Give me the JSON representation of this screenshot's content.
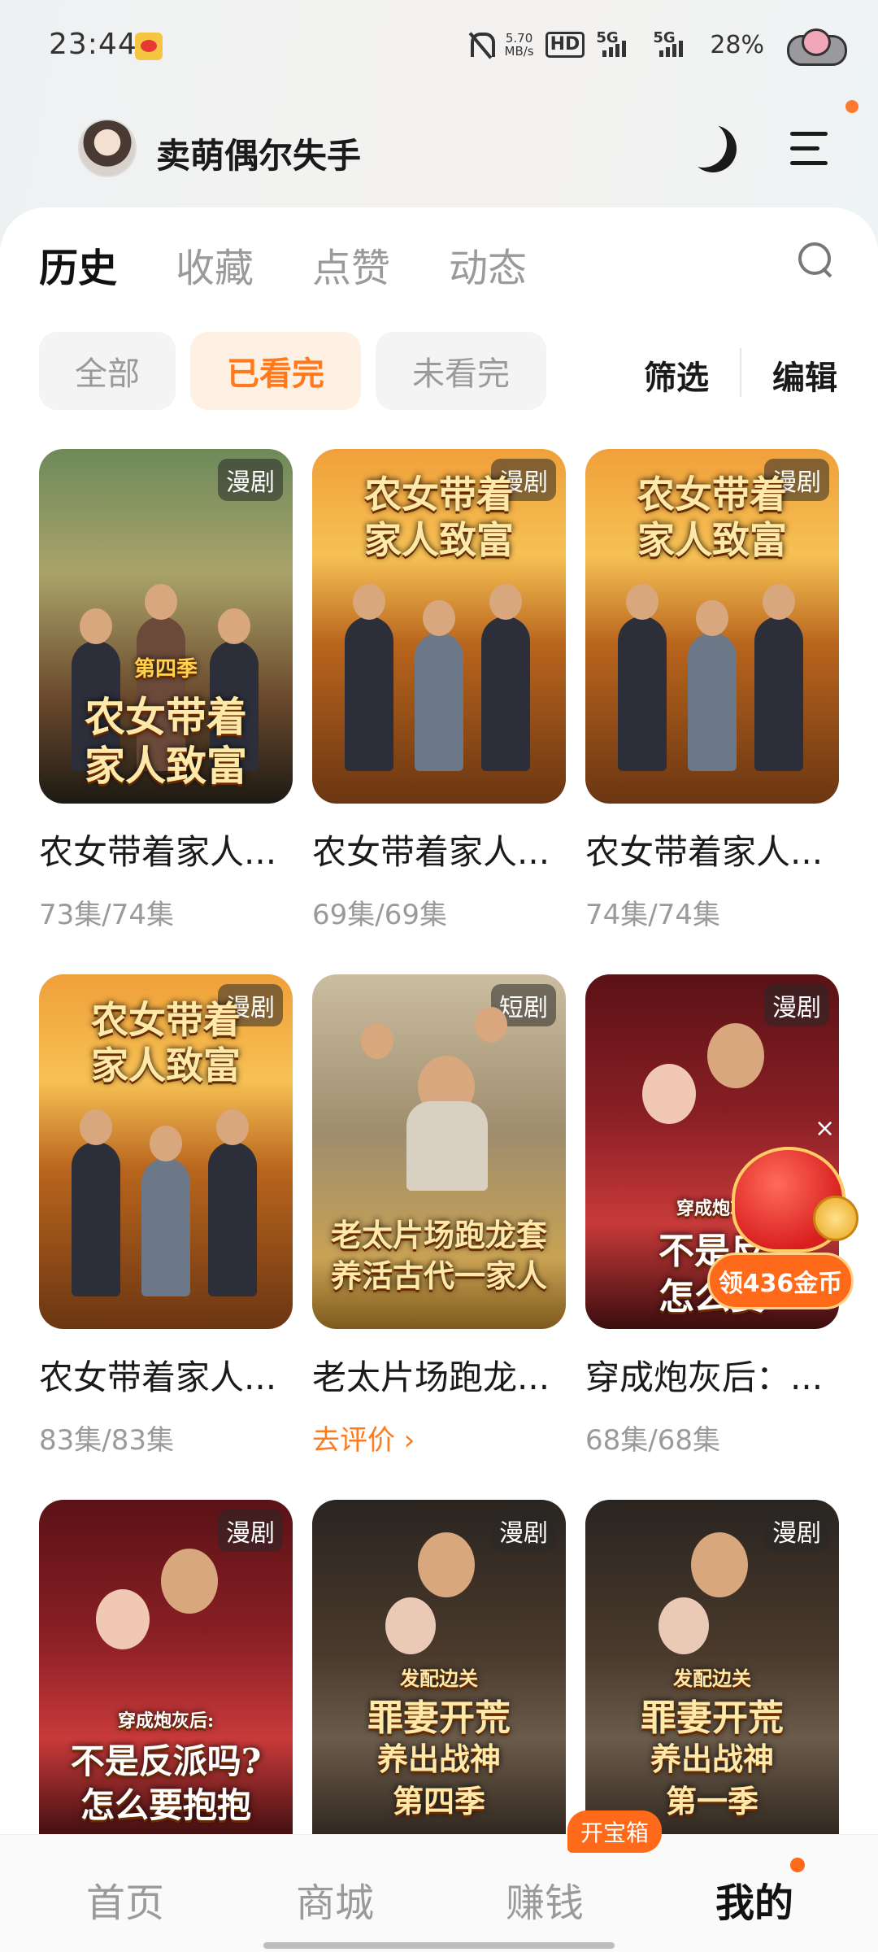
{
  "status_bar": {
    "time": "23:44",
    "net_speed_value": "5.70",
    "net_speed_unit": "MB/s",
    "hd_label": "HD",
    "signal1": "5G",
    "signal2": "5G",
    "battery": "28%"
  },
  "user": {
    "name": "卖萌偶尔失手"
  },
  "tabs": [
    {
      "label": "历史",
      "active": true
    },
    {
      "label": "收藏",
      "active": false
    },
    {
      "label": "点赞",
      "active": false
    },
    {
      "label": "动态",
      "active": false
    }
  ],
  "filters": {
    "chips": [
      {
        "label": "全部",
        "selected": false
      },
      {
        "label": "已看完",
        "selected": true
      },
      {
        "label": "未看完",
        "selected": false
      }
    ],
    "filter_label": "筛选",
    "edit_label": "编辑"
  },
  "items": [
    {
      "title": "农女带着家人...",
      "sub": "73集/74集",
      "badge": "漫剧",
      "poster_text_1": "第四季",
      "poster_text_2": "农女带着",
      "poster_text_3": "家人致富"
    },
    {
      "title": "农女带着家人...",
      "sub": "69集/69集",
      "badge": "漫剧",
      "poster_text_1": "农女带着",
      "poster_text_2": "家人致富"
    },
    {
      "title": "农女带着家人...",
      "sub": "74集/74集",
      "badge": "漫剧",
      "poster_text_1": "农女带着",
      "poster_text_2": "家人致富"
    },
    {
      "title": "农女带着家人...",
      "sub": "83集/83集",
      "badge": "漫剧",
      "poster_text_1": "农女带着",
      "poster_text_2": "家人致富"
    },
    {
      "title": "老太片场跑龙...",
      "sub": "去评价 ›",
      "badge": "短剧",
      "poster_text_1": "老太片场跑龙套",
      "poster_text_2": "养活古代一家人"
    },
    {
      "title": "穿成炮灰后：...",
      "sub": "68集/68集",
      "badge": "漫剧",
      "poster_text_1": "穿成炮灰",
      "poster_text_2": "不是反",
      "poster_text_3": "怎么要"
    },
    {
      "badge": "漫剧",
      "poster_text_1": "穿成炮灰后:",
      "poster_text_2": "不是反派吗?",
      "poster_text_3": "怎么要抱抱"
    },
    {
      "badge": "漫剧",
      "poster_text_1": "发配边关",
      "poster_text_2": "罪妻开荒",
      "poster_text_3": "养出战神",
      "poster_text_4": "第四季"
    },
    {
      "badge": "漫剧",
      "poster_text_1": "发配边关",
      "poster_text_2": "罪妻开荒",
      "poster_text_3": "养出战神",
      "poster_text_4": "第一季"
    }
  ],
  "promo": {
    "coin_label": "领436金币",
    "close": "×"
  },
  "bottom_nav": [
    {
      "label": "首页",
      "active": false
    },
    {
      "label": "商城",
      "active": false
    },
    {
      "label": "赚钱",
      "active": false
    },
    {
      "label": "我的",
      "active": true
    }
  ],
  "treasure_badge": "开宝箱",
  "colors": {
    "accent": "#ff7a1e",
    "chip_selected_bg": "#fff0e4"
  }
}
